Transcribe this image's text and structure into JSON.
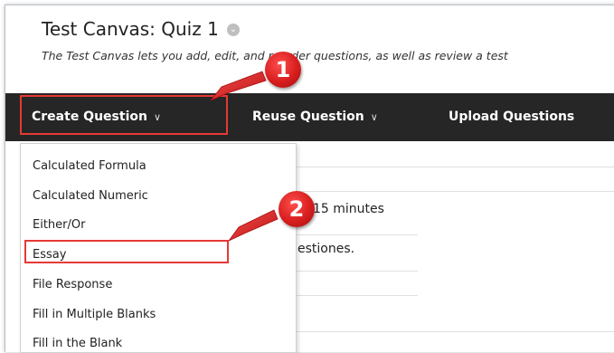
{
  "page": {
    "title": "Test Canvas: Quiz 1",
    "description": "The Test Canvas lets you add, edit, and reorder questions, as well as review a test"
  },
  "toolbar": {
    "create_label": "Create Question",
    "reuse_label": "Reuse Question",
    "upload_label": "Upload Questions",
    "caret_icon": "chevron-down-icon"
  },
  "content": {
    "line1": "15 minutes",
    "line2": "estiones."
  },
  "menu": {
    "items": [
      {
        "label": "Calculated Formula"
      },
      {
        "label": "Calculated Numeric"
      },
      {
        "label": "Either/Or"
      },
      {
        "label": "Essay"
      },
      {
        "label": "File Response"
      },
      {
        "label": "Fill in Multiple Blanks"
      },
      {
        "label": "Fill in the Blank"
      }
    ]
  },
  "callouts": {
    "step1": "1",
    "step2": "2"
  },
  "colors": {
    "toolbar_bg": "#262626",
    "highlight": "#e53935",
    "badge": "#d81e1e"
  }
}
